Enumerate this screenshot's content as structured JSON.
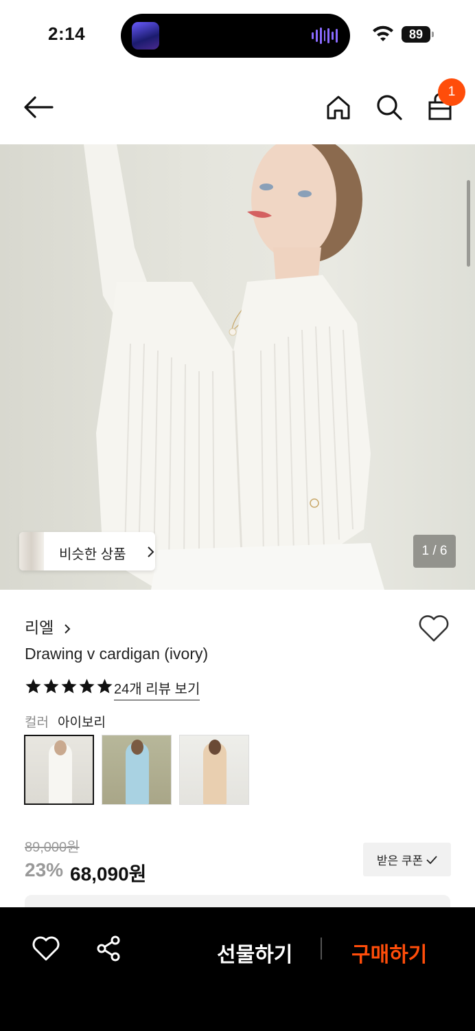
{
  "status_bar": {
    "time": "2:14",
    "battery": "89"
  },
  "header": {
    "cart_count": "1"
  },
  "hero": {
    "similar_label": "비슷한 상품",
    "image_counter": "1 / 6"
  },
  "product": {
    "brand": "리엘",
    "name": "Drawing v cardigan (ivory)",
    "rating_stars": 5,
    "review_link": "24개 리뷰 보기",
    "color_label": "컬러",
    "color_value": "아이보리",
    "swatches": [
      {
        "name": "ivory",
        "selected": true
      },
      {
        "name": "sky-blue",
        "selected": false
      },
      {
        "name": "beige",
        "selected": false
      }
    ],
    "original_price": "89,000원",
    "discount": "23%",
    "price": "68,090원",
    "coupon_label": "받은 쿠폰"
  },
  "bottom_bar": {
    "gift_label": "선물하기",
    "buy_label": "구매하기"
  },
  "colors": {
    "accent": "#ff4d0a",
    "bottom_bar_bg": "#000000"
  }
}
